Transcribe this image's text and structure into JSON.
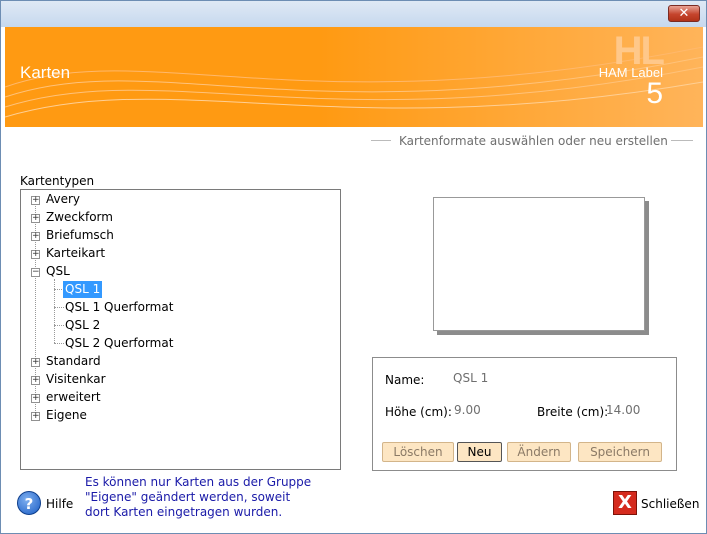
{
  "window": {
    "close_glyph": "✕"
  },
  "banner": {
    "title": "Karten",
    "logo_mark": "HL",
    "logo_text": "HAM Label",
    "logo_number": "5"
  },
  "subtitle": "Kartenformate auswählen oder neu erstellen",
  "tree": {
    "label": "Kartentypen",
    "items": [
      {
        "label": "Avery",
        "state": "+"
      },
      {
        "label": "Zweckform",
        "state": "+"
      },
      {
        "label": "Briefumsch",
        "state": "+"
      },
      {
        "label": "Karteikart",
        "state": "+"
      },
      {
        "label": "QSL",
        "state": "−"
      },
      {
        "label": "QSL 1"
      },
      {
        "label": "QSL 1 Querformat"
      },
      {
        "label": "QSL 2"
      },
      {
        "label": "QSL 2 Querformat"
      },
      {
        "label": "Standard",
        "state": "+"
      },
      {
        "label": "Visitenkar",
        "state": "+"
      },
      {
        "label": "erweitert",
        "state": "+"
      },
      {
        "label": "Eigene",
        "state": "+"
      }
    ]
  },
  "details": {
    "name_label": "Name:",
    "name_value": "QSL 1",
    "height_label": "Höhe (cm):",
    "height_value": "9.00",
    "width_label": "Breite (cm):",
    "width_value": "14.00",
    "delete_label": "Löschen",
    "new_label": "Neu",
    "edit_label": "Ändern",
    "save_label": "Speichern"
  },
  "notice": "Es können nur Karten aus der Gruppe \"Eigene\" geändert werden, soweit dort Karten eingetragen wurden.",
  "help": {
    "icon": "?",
    "label": "Hilfe"
  },
  "close": {
    "icon": "X",
    "label": "Schließen"
  }
}
